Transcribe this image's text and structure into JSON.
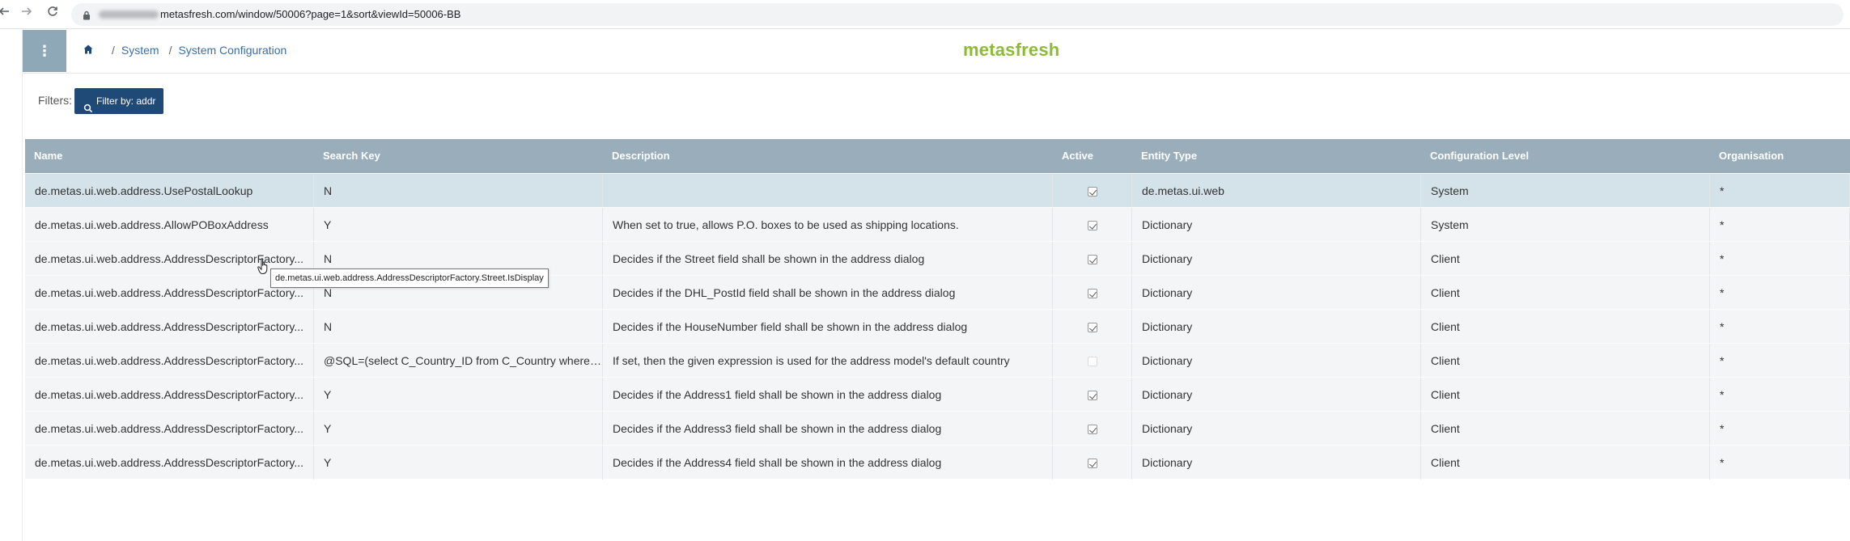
{
  "browser": {
    "back_icon": "back-arrow-icon",
    "forward_icon": "forward-arrow-icon",
    "reload_icon": "reload-icon",
    "url": "metasfresh.com/window/50006?page=1&sort&viewId=50006-BB"
  },
  "header": {
    "menu_icon": "vertical-dots-icon",
    "breadcrumb": [
      "System",
      "System Configuration"
    ],
    "logo": "metasfresh"
  },
  "filters": {
    "label": "Filters:",
    "button_label": "Filter by: addr"
  },
  "table": {
    "columns": [
      "Name",
      "Search Key",
      "Description",
      "Active",
      "Entity Type",
      "Configuration Level",
      "Organisation"
    ],
    "rows": [
      {
        "name": "de.metas.ui.web.address.UsePostalLookup",
        "search_key": "N",
        "description": "",
        "active": true,
        "entity_type": "de.metas.ui.web",
        "config_level": "System",
        "organisation": "*"
      },
      {
        "name": "de.metas.ui.web.address.AllowPOBoxAddress",
        "search_key": "Y",
        "description": "When set to true, allows P.O. boxes to be used as shipping locations.",
        "active": true,
        "entity_type": "Dictionary",
        "config_level": "System",
        "organisation": "*"
      },
      {
        "name": "de.metas.ui.web.address.AddressDescriptorFactory...",
        "search_key": "N",
        "description": "Decides if the Street field shall be shown in the address dialog",
        "active": true,
        "entity_type": "Dictionary",
        "config_level": "Client",
        "organisation": "*"
      },
      {
        "name": "de.metas.ui.web.address.AddressDescriptorFactory...",
        "search_key": "N",
        "description": "Decides if the DHL_PostId field shall be shown in the address dialog",
        "active": true,
        "entity_type": "Dictionary",
        "config_level": "Client",
        "organisation": "*"
      },
      {
        "name": "de.metas.ui.web.address.AddressDescriptorFactory...",
        "search_key": "N",
        "description": "Decides if the HouseNumber field shall be shown in the address dialog",
        "active": true,
        "entity_type": "Dictionary",
        "config_level": "Client",
        "organisation": "*"
      },
      {
        "name": "de.metas.ui.web.address.AddressDescriptorFactory...",
        "search_key": "@SQL=(select C_Country_ID from C_Country where ...",
        "description": "If set, then the given expression is used for the address model's default country",
        "active": false,
        "entity_type": "Dictionary",
        "config_level": "Client",
        "organisation": "*"
      },
      {
        "name": "de.metas.ui.web.address.AddressDescriptorFactory...",
        "search_key": "Y",
        "description": "Decides if the Address1 field shall be shown in the address dialog",
        "active": true,
        "entity_type": "Dictionary",
        "config_level": "Client",
        "organisation": "*"
      },
      {
        "name": "de.metas.ui.web.address.AddressDescriptorFactory...",
        "search_key": "Y",
        "description": "Decides if the Address3 field shall be shown in the address dialog",
        "active": true,
        "entity_type": "Dictionary",
        "config_level": "Client",
        "organisation": "*"
      },
      {
        "name": "de.metas.ui.web.address.AddressDescriptorFactory...",
        "search_key": "Y",
        "description": "Decides if the Address4 field shall be shown in the address dialog",
        "active": true,
        "entity_type": "Dictionary",
        "config_level": "Client",
        "organisation": "*"
      }
    ]
  },
  "tooltip": {
    "text": "de.metas.ui.web.address.AddressDescriptorFactory.Street.IsDisplay"
  },
  "colors": {
    "header_bg": "#99adbb",
    "menu_bg": "#8fa8b8",
    "filter_btn_bg": "#1f4a78",
    "logo": "#8cbc35",
    "selected_row": "#d4e2ea",
    "row_bg": "#f4f5f7",
    "link": "#3a6fa6"
  }
}
